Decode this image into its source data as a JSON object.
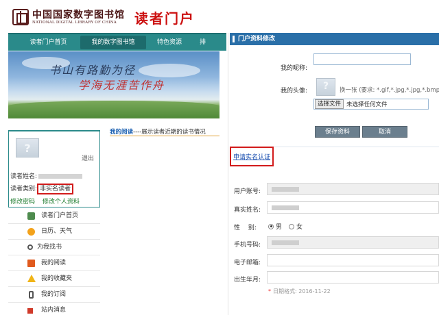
{
  "header": {
    "logo_cn": "中国国家数字图书馆",
    "logo_en": "NATIONAL DIGITAL LIBRARY OF CHINA",
    "portal_title": "读者门户"
  },
  "nav": {
    "items": [
      {
        "label": "读者门户首页"
      },
      {
        "label": "我的数字图书馆"
      },
      {
        "label": "特色资源"
      },
      {
        "label": "排"
      }
    ]
  },
  "banner": {
    "line1": "书山有路勤为径",
    "line2": "学海无涯苦作舟"
  },
  "reading": {
    "title": "我的阅读",
    "desc": "----展示读者近期的读书情况"
  },
  "user": {
    "logout": "退出",
    "name_label": "读者姓名:",
    "type_label": "读者类别:",
    "type_value": "非实名读者",
    "change_password": "修改密码",
    "edit_profile": "修改个人资料"
  },
  "menu": {
    "items": [
      {
        "label": "读者门户首页",
        "icon": "home-icon"
      },
      {
        "label": "日历、天气",
        "icon": "sun-icon"
      },
      {
        "label": "为我找书",
        "icon": "search-icon"
      },
      {
        "label": "我的阅读",
        "icon": "book-icon"
      },
      {
        "label": "我的收藏夹",
        "icon": "star-icon"
      },
      {
        "label": "我的订阅",
        "icon": "phone-icon"
      },
      {
        "label": "站内消息",
        "icon": "speaker-icon"
      }
    ]
  },
  "profile_form": {
    "title": "门户资料修改",
    "nickname_label": "我的昵称:",
    "nickname_value": "",
    "avatar_label": "我的头像:",
    "change_tip": "换一张 (要求: *.gif,*.jpg,*.jpg,*.bmp",
    "choose_file": "选择文件",
    "no_file": "未选择任何文件",
    "save": "保存资料",
    "cancel": "取消"
  },
  "realname": {
    "link": "申请实名认证",
    "account_label": "用户账号:",
    "realname_label": "真实姓名:",
    "gender_label": "性　 别:",
    "gender_male": "男",
    "gender_female": "女",
    "gender_selected": "男",
    "phone_label": "手机号码:",
    "email_label": "电子邮箱:",
    "birth_label": "出生年月:",
    "date_format_tip": "日期格式: 2016-11-22",
    "required_mark": "*"
  },
  "colors": {
    "nav_bg": "#2a8a8a",
    "panel_head": "#2a6fa8",
    "highlight_box": "#d21b1b",
    "portal_title": "#cc1010"
  }
}
